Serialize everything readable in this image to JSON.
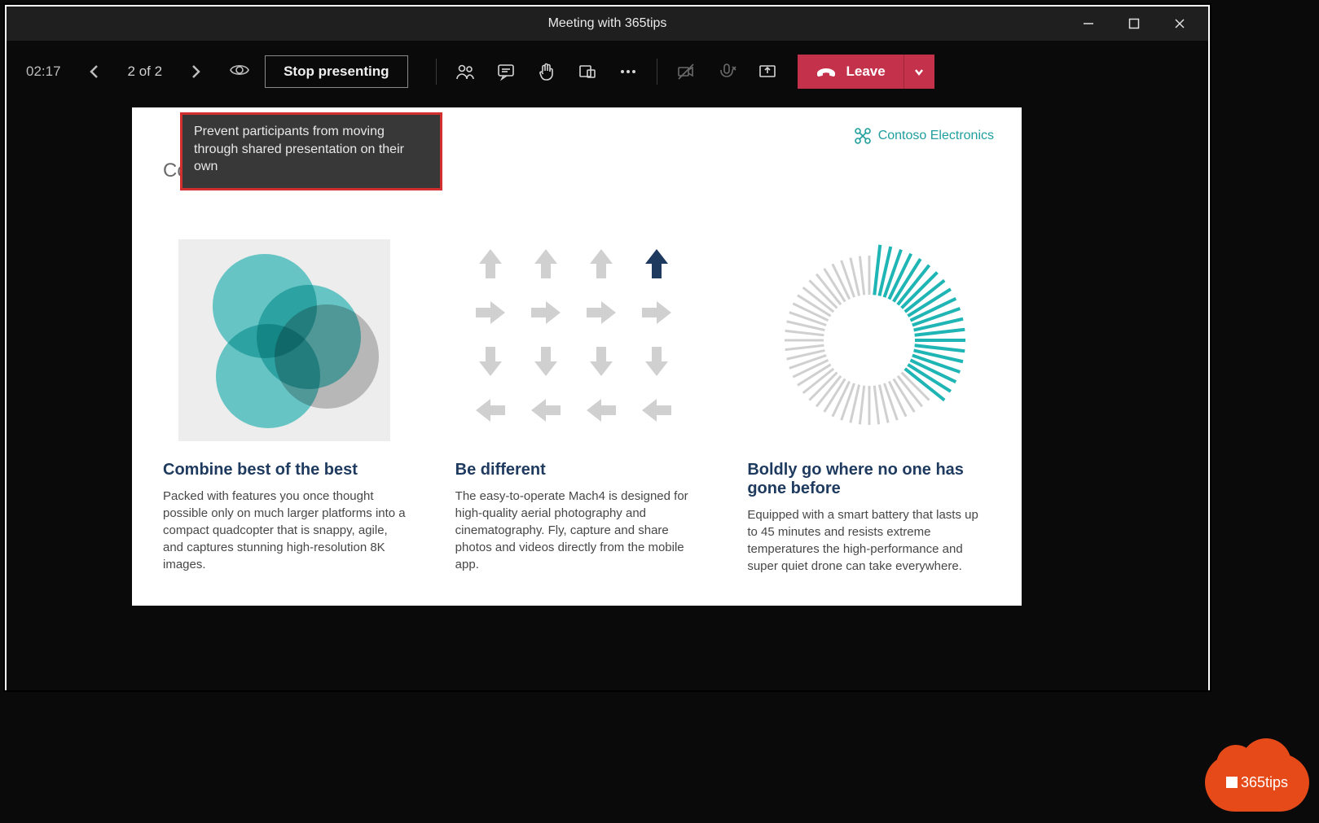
{
  "window": {
    "title": "Meeting with 365tips"
  },
  "toolbar": {
    "time": "02:17",
    "slide_counter": "2 of 2",
    "stop_presenting": "Stop presenting",
    "leave_label": "Leave"
  },
  "tooltip": {
    "text": "Prevent participants from moving through shared presentation on their own"
  },
  "slide": {
    "partial_heading": "Co",
    "brand": "Contoso Electronics",
    "columns": [
      {
        "heading": "Combine best of the best",
        "body": "Packed with features you once thought possible only on much larger platforms into a compact quadcopter that is snappy, agile, and captures stunning high-resolution 8K images."
      },
      {
        "heading": "Be different",
        "body": "The easy-to-operate Mach4 is designed for high-quality aerial photography and cinematography. Fly, capture and share photos and videos directly from the mobile app."
      },
      {
        "heading": "Boldly go where no one has gone before",
        "body": "Equipped with a smart battery that lasts up to 45 minutes and resists extreme temperatures the high-performance and super quiet drone can take everywhere."
      }
    ]
  },
  "watermark": {
    "label": "365tips"
  }
}
